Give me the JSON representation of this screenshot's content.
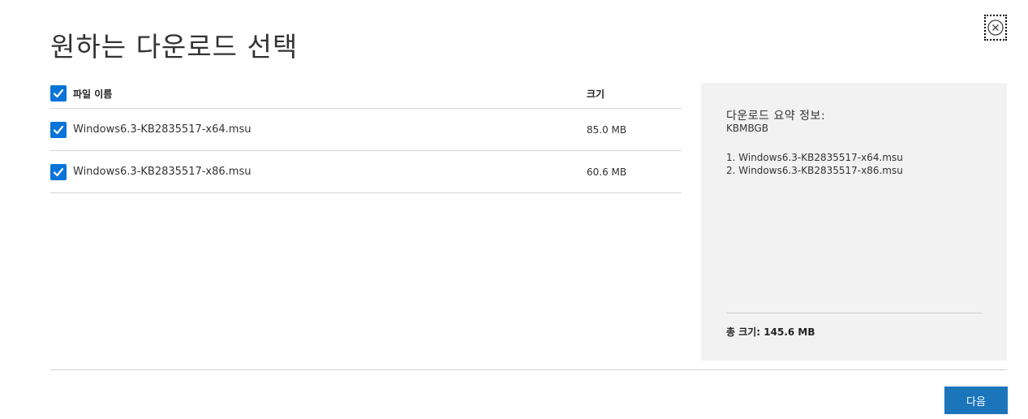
{
  "dialog": {
    "title": "원하는 다운로드 선택",
    "close_icon": "close-circle-icon"
  },
  "file_table": {
    "header": {
      "name_label": "파일 이름",
      "size_label": "크기",
      "checked": true
    },
    "rows": [
      {
        "name": "Windows6.3-KB2835517-x64.msu",
        "size": "85.0 MB",
        "checked": true
      },
      {
        "name": "Windows6.3-KB2835517-x86.msu",
        "size": "60.6 MB",
        "checked": true
      }
    ]
  },
  "summary": {
    "title": "다운로드 요약 정보:",
    "subtitle": "KBMBGB",
    "items": [
      "1. Windows6.3-KB2835517-x64.msu",
      "2. Windows6.3-KB2835517-x86.msu"
    ],
    "total": "총 크기: 145.6 MB"
  },
  "footer": {
    "next_label": "다음"
  },
  "colors": {
    "accent": "#0b74d9",
    "button": "#1b75bb",
    "summary_bg": "#f2f2f2"
  }
}
